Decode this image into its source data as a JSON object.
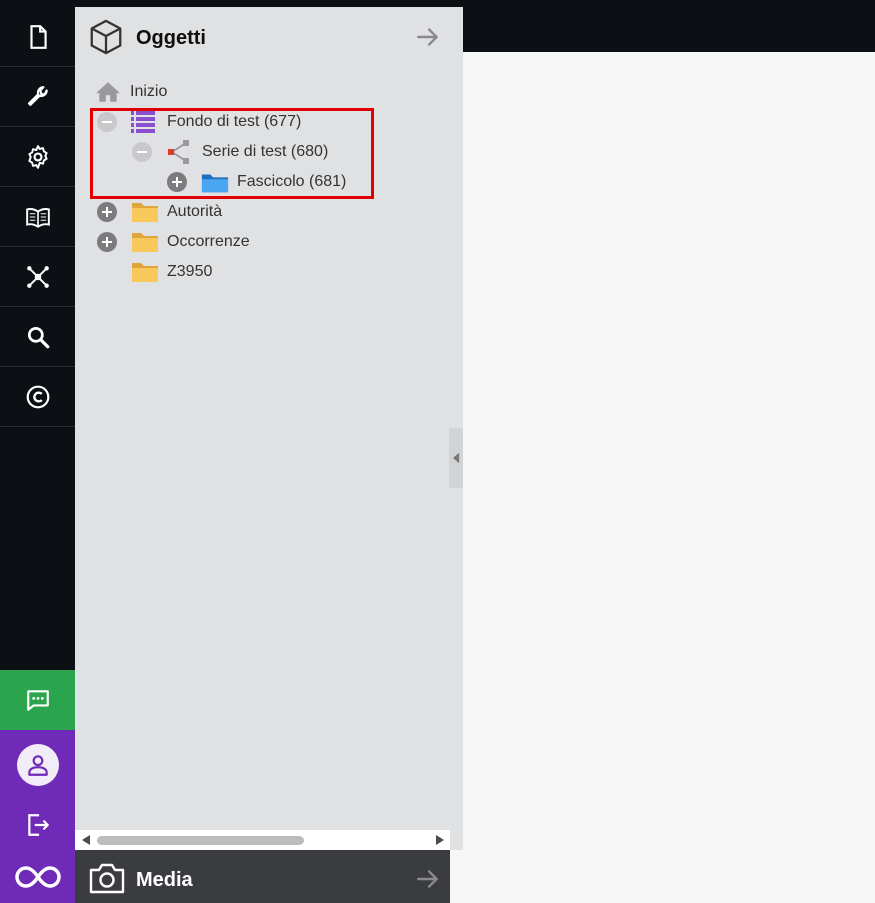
{
  "panel": {
    "title": "Oggetti"
  },
  "tree": [
    {
      "label": "Inizio",
      "icon": "home-icon",
      "toggle": "none"
    },
    {
      "label": "Fondo di test (677)",
      "icon": "list-stack-icon",
      "toggle": "minus"
    },
    {
      "label": "Serie di test (680)",
      "icon": "share-node-icon",
      "toggle": "minus"
    },
    {
      "label": "Fascicolo (681)",
      "icon": "blue-folder-icon",
      "toggle": "plus"
    },
    {
      "label": "Autorità",
      "icon": "folder-icon",
      "toggle": "plus"
    },
    {
      "label": "Occorrenze",
      "icon": "folder-icon",
      "toggle": "plus"
    },
    {
      "label": "Z3950",
      "icon": "folder-icon",
      "toggle": "none"
    }
  ],
  "media": {
    "title": "Media"
  },
  "colors": {
    "rail": "#0c0f13",
    "chat": "#2aa54d",
    "brand": "#6f2ab8",
    "panel": "#e0e1e3",
    "highlight": "#e00000"
  }
}
